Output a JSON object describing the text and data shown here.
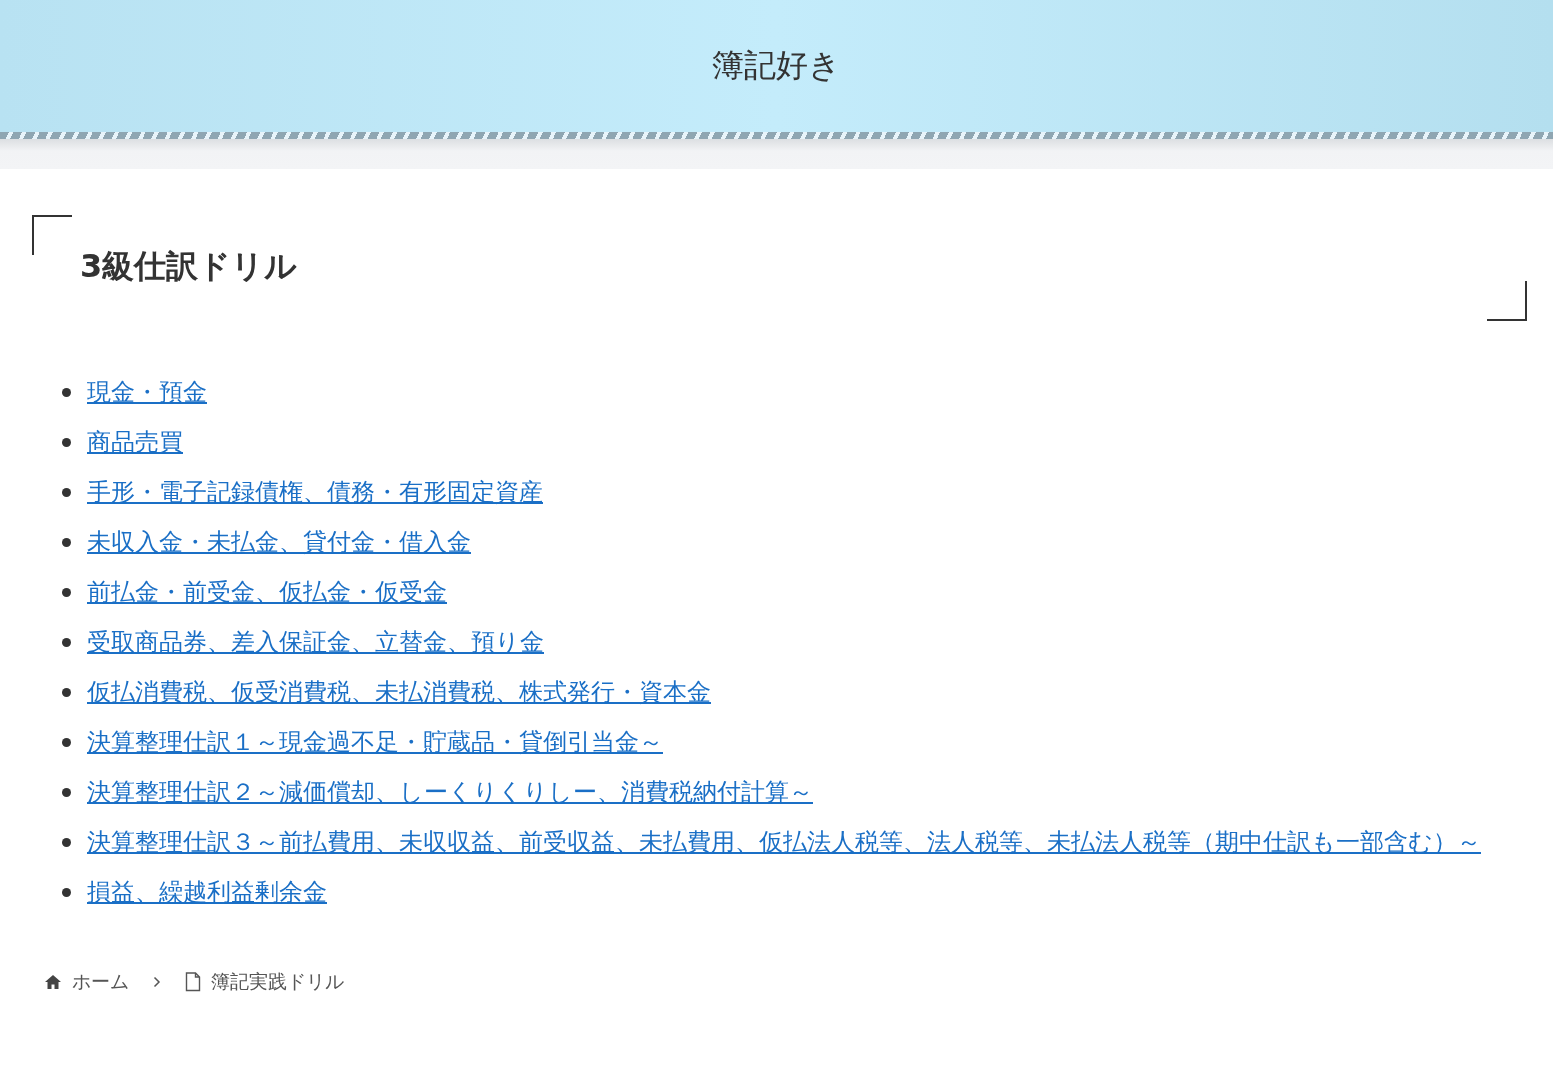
{
  "site_title": "簿記好き",
  "page_title": "3級仕訳ドリル",
  "links": [
    {
      "label": "現金・預金"
    },
    {
      "label": "商品売買"
    },
    {
      "label": "手形・電子記録債権、債務・有形固定資産"
    },
    {
      "label": "未収入金・未払金、貸付金・借入金"
    },
    {
      "label": "前払金・前受金、仮払金・仮受金"
    },
    {
      "label": "受取商品券、差入保証金、立替金、預り金"
    },
    {
      "label": "仮払消費税、仮受消費税、未払消費税、株式発行・資本金"
    },
    {
      "label": "決算整理仕訳１～現金過不足・貯蔵品・貸倒引当金～"
    },
    {
      "label": "決算整理仕訳２～減価償却、しーくりくりしー、消費税納付計算～"
    },
    {
      "label": "決算整理仕訳３～前払費用、未収収益、前受収益、未払費用、仮払法人税等、法人税等、未払法人税等（期中仕訳も一部含む）～"
    },
    {
      "label": "損益、繰越利益剰余金"
    }
  ],
  "breadcrumb": [
    {
      "label": "ホーム",
      "kind": "home"
    },
    {
      "label": "簿記実践ドリル",
      "kind": "page"
    }
  ]
}
